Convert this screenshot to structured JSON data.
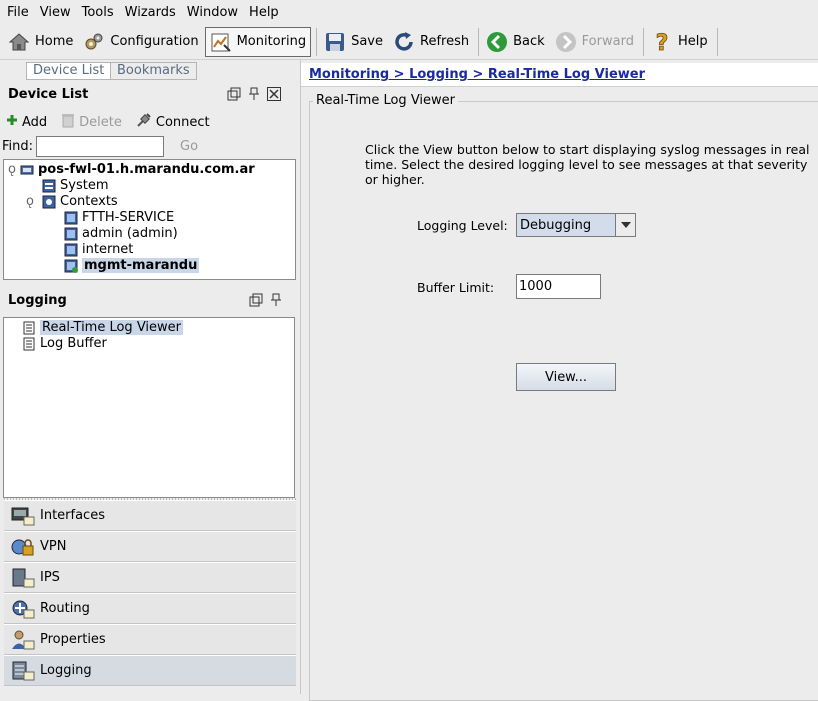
{
  "menu": [
    "File",
    "View",
    "Tools",
    "Wizards",
    "Window",
    "Help"
  ],
  "toolbar": {
    "home": "Home",
    "configuration": "Configuration",
    "monitoring": "Monitoring",
    "save": "Save",
    "refresh": "Refresh",
    "back": "Back",
    "forward": "Forward",
    "help": "Help"
  },
  "tabs": {
    "device_list": "Device List",
    "bookmarks": "Bookmarks"
  },
  "device_list": {
    "title": "Device List",
    "add": "Add",
    "delete": "Delete",
    "connect": "Connect",
    "find_label": "Find:",
    "go": "Go",
    "tree": {
      "root": "pos-fwl-01.h.marandu.com.ar",
      "system": "System",
      "contexts": "Contexts",
      "children": [
        "FTTH-SERVICE",
        "admin (admin)",
        "internet",
        "mgmt-marandu"
      ]
    }
  },
  "logging": {
    "title": "Logging",
    "items": [
      "Real-Time Log Viewer",
      "Log Buffer"
    ]
  },
  "nav": [
    "Interfaces",
    "VPN",
    "IPS",
    "Routing",
    "Properties",
    "Logging"
  ],
  "main": {
    "breadcrumb": "Monitoring > Logging > Real-Time Log Viewer",
    "group_title": "Real-Time Log Viewer",
    "description": "Click the View button below to start displaying syslog messages in real time. Select the desired logging level to see messages at that severity or higher.",
    "logging_level_label": "Logging Level:",
    "logging_level_value": "Debugging",
    "buffer_limit_label": "Buffer Limit:",
    "buffer_limit_value": "1000",
    "view_button": "View..."
  }
}
